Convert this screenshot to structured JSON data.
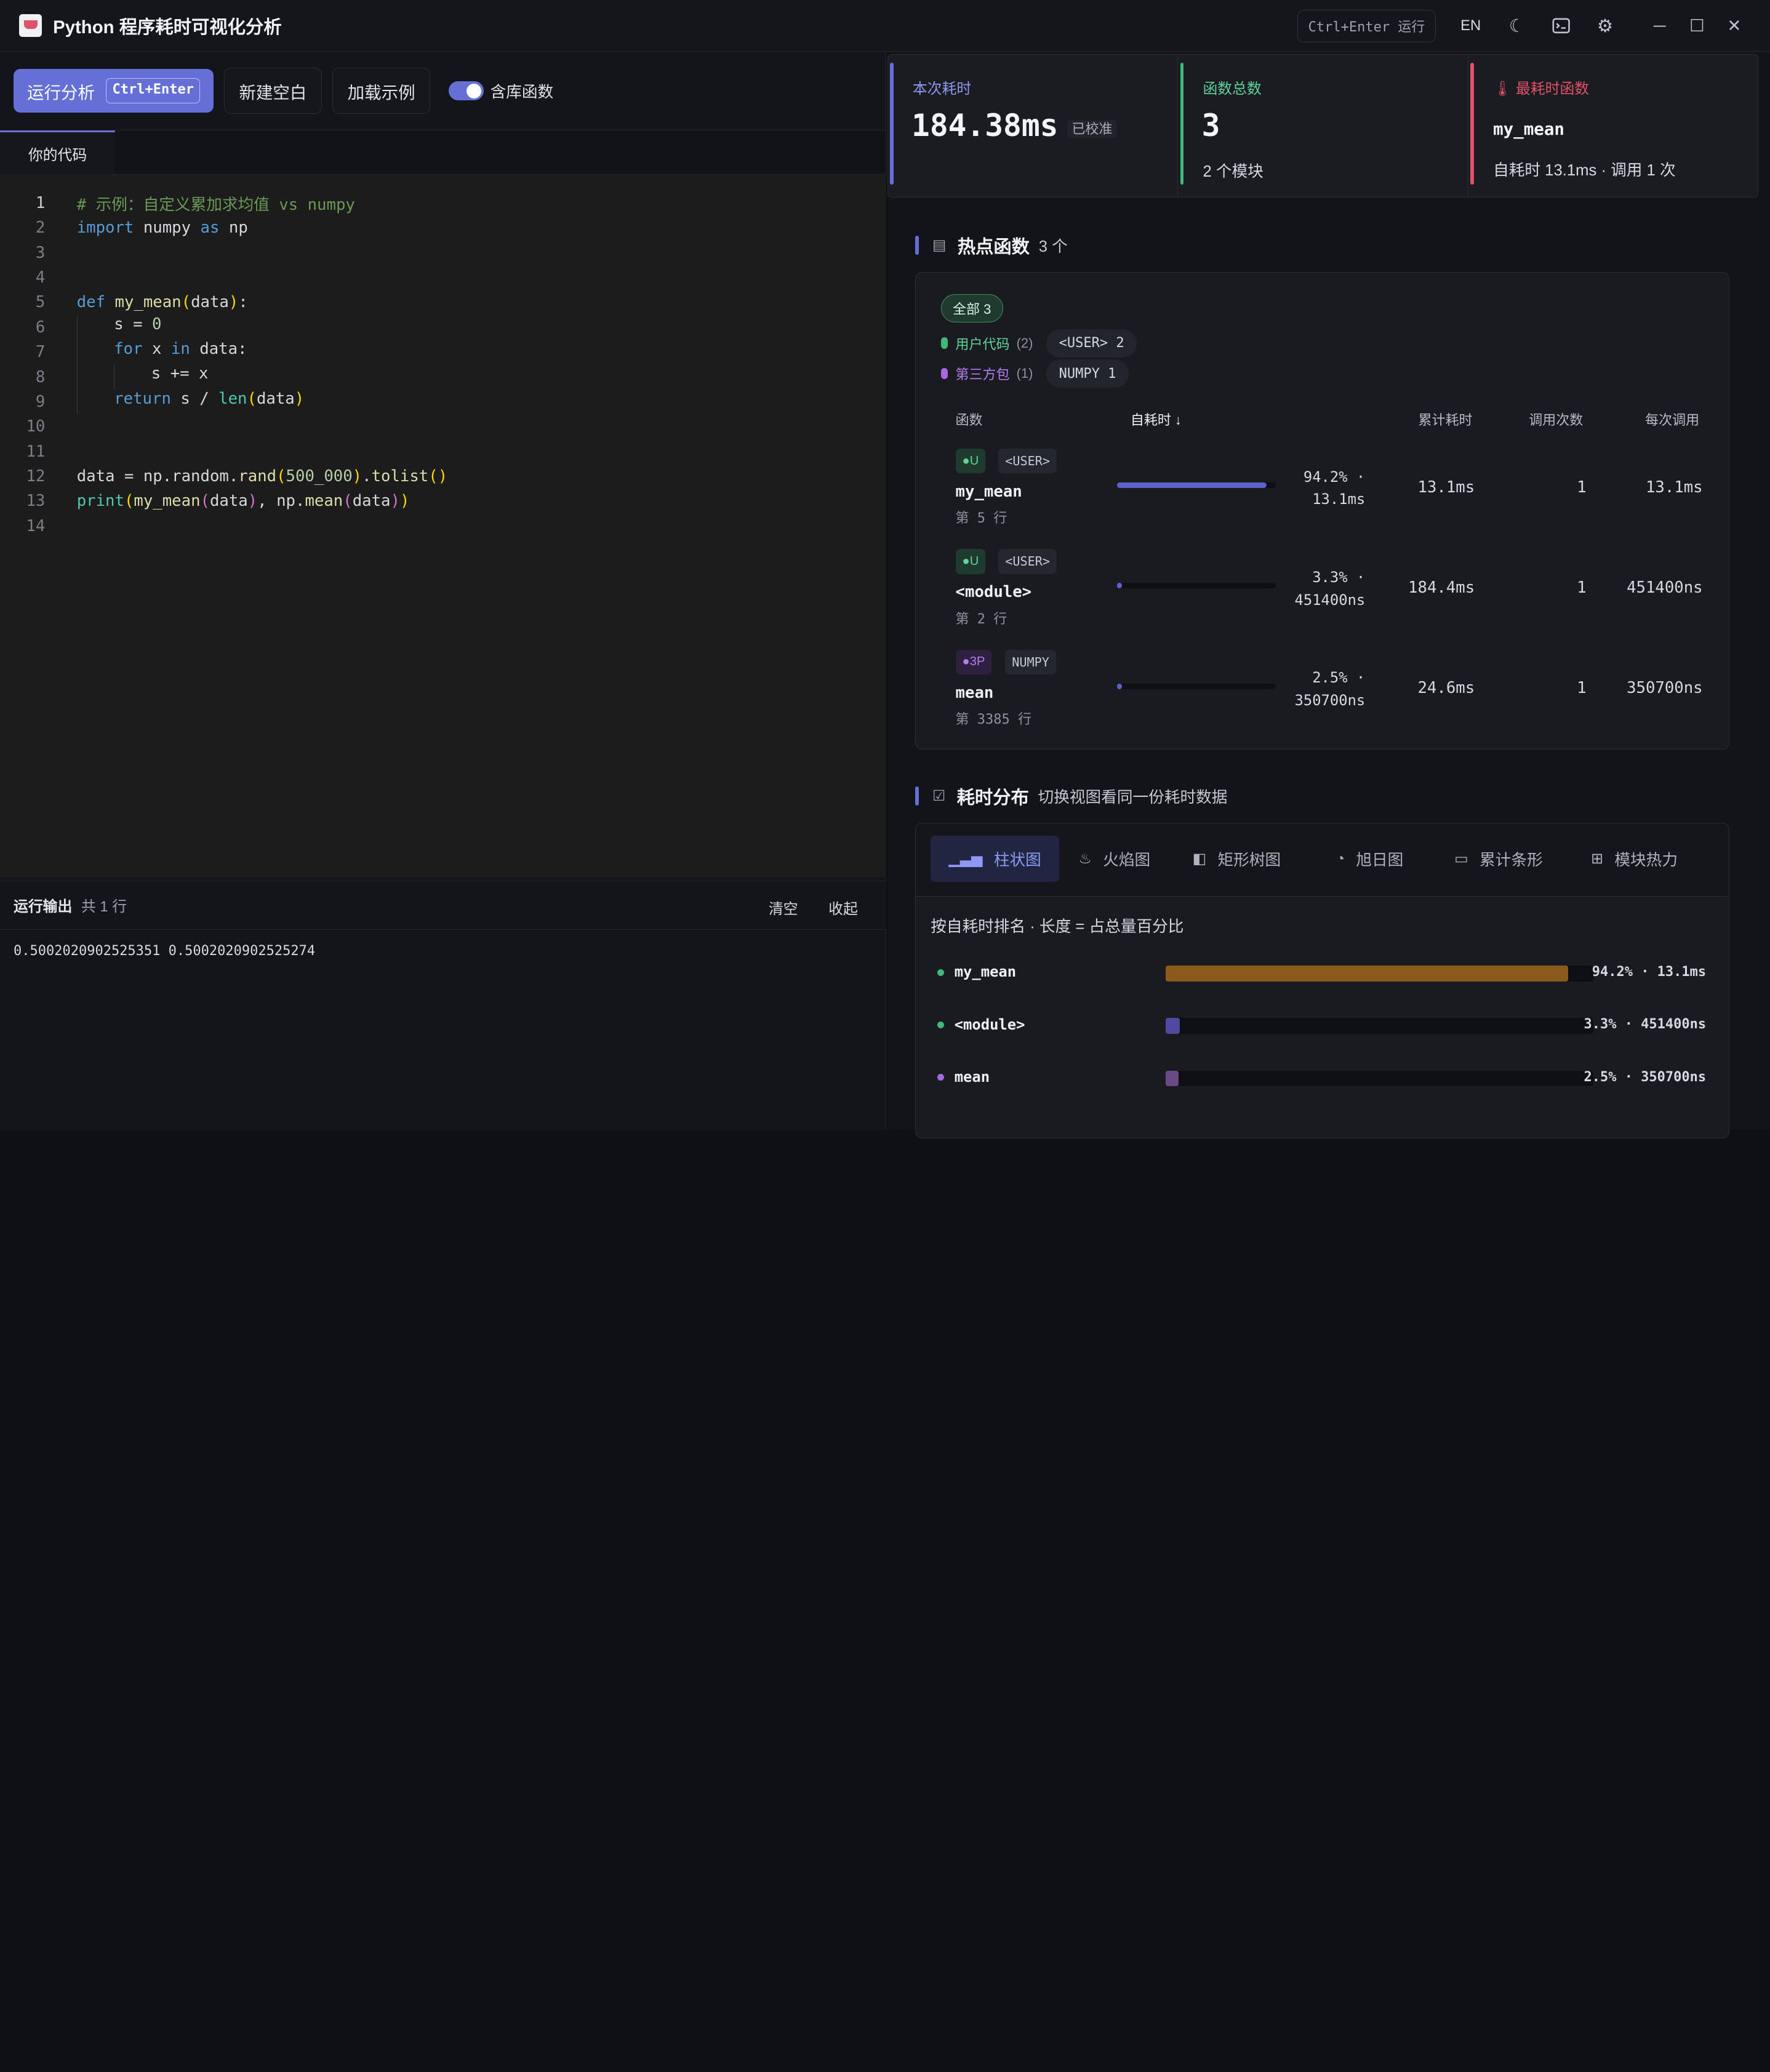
{
  "app": {
    "title": "Python 程序耗时可视化分析"
  },
  "titlebar": {
    "shortcut": "Ctrl+Enter 运行",
    "lang": "EN"
  },
  "toolbar": {
    "run_label": "运行分析",
    "run_kbd": "Ctrl+Enter",
    "new_label": "新建空白",
    "example_label": "加载示例",
    "toggle_label": "含库函数",
    "toggle_on": true
  },
  "editor": {
    "tab": "你的代码",
    "current_line": 1,
    "lines": [
      "# 示例：自定义累加求均值 vs numpy",
      "import numpy as np",
      "",
      "",
      "def my_mean(data):",
      "    s = 0",
      "    for x in data:",
      "        s += x",
      "    return s / len(data)",
      "",
      "",
      "data = np.random.rand(500_000).tolist()",
      "print(my_mean(data), np.mean(data))",
      ""
    ]
  },
  "output": {
    "title": "运行输出",
    "count": "共 1 行",
    "clear": "清空",
    "collapse": "收起",
    "text": "0.5002020902525351 0.5002020902525274"
  },
  "stats": {
    "time_label": "本次耗时",
    "time_value": "184.38ms",
    "calibrated": "已校准",
    "funcs_label": "函数总数",
    "funcs_value": "3",
    "modules": "2 个模块",
    "slowest_label": "最耗时函数",
    "slowest_name": "my_mean",
    "slowest_detail": "自耗时 13.1ms · 调用 1 次",
    "colors": {
      "time": "#6470d6",
      "funcs": "#3fb87a",
      "slowest": "#e0516a"
    }
  },
  "hot": {
    "title": "热点函数",
    "count": "3 个",
    "filter_all": "全部 3",
    "user_label": "用户代码",
    "user_count": "(2)",
    "user_chip": "<USER> 2",
    "third_label": "第三方包",
    "third_count": "(1)",
    "third_chip": "NUMPY 1",
    "headers": {
      "func": "函数",
      "self": "自耗时 ↓",
      "cum": "累计耗时",
      "calls": "调用次数",
      "per_call": "每次调用"
    },
    "rows": [
      {
        "tag": "U",
        "module": "<USER>",
        "name": "my_mean",
        "line": "第 5 行",
        "pct_line1": "94.2% ·",
        "pct_line2": "13.1ms",
        "fraction": 0.942,
        "cum": "13.1ms",
        "calls": "1",
        "per_call": "13.1ms"
      },
      {
        "tag": "U",
        "module": "<USER>",
        "name": "<module>",
        "line": "第 2 行",
        "pct_line1": "3.3% ·",
        "pct_line2": "451400ns",
        "fraction": 0.033,
        "cum": "184.4ms",
        "calls": "1",
        "per_call": "451400ns"
      },
      {
        "tag": "3P",
        "module": "NUMPY",
        "name": "mean",
        "line": "第 3385 行",
        "pct_line1": "2.5% ·",
        "pct_line2": "350700ns",
        "fraction": 0.025,
        "cum": "24.6ms",
        "calls": "1",
        "per_call": "350700ns"
      }
    ]
  },
  "dist": {
    "title": "耗时分布",
    "subtitle": "切换视图看同一份耗时数据",
    "tabs": [
      "柱状图",
      "火焰图",
      "矩形树图",
      "旭日图",
      "累计条形",
      "模块热力"
    ],
    "active_tab": 0,
    "note": "按自耗时排名 · 长度 = 占总量百分比",
    "bars": [
      {
        "name": "my_mean",
        "value": "94.2% · 13.1ms",
        "percent": 94.2,
        "color": "#8a5a1c",
        "dot": "#3fb87a"
      },
      {
        "name": "<module>",
        "value": "3.3% · 451400ns",
        "percent": 3.3,
        "color": "#4d4aa0",
        "dot": "#3fb87a"
      },
      {
        "name": "mean",
        "value": "2.5% · 350700ns",
        "percent": 2.5,
        "color": "#6a4a86",
        "dot": "#a66ae0"
      }
    ]
  }
}
